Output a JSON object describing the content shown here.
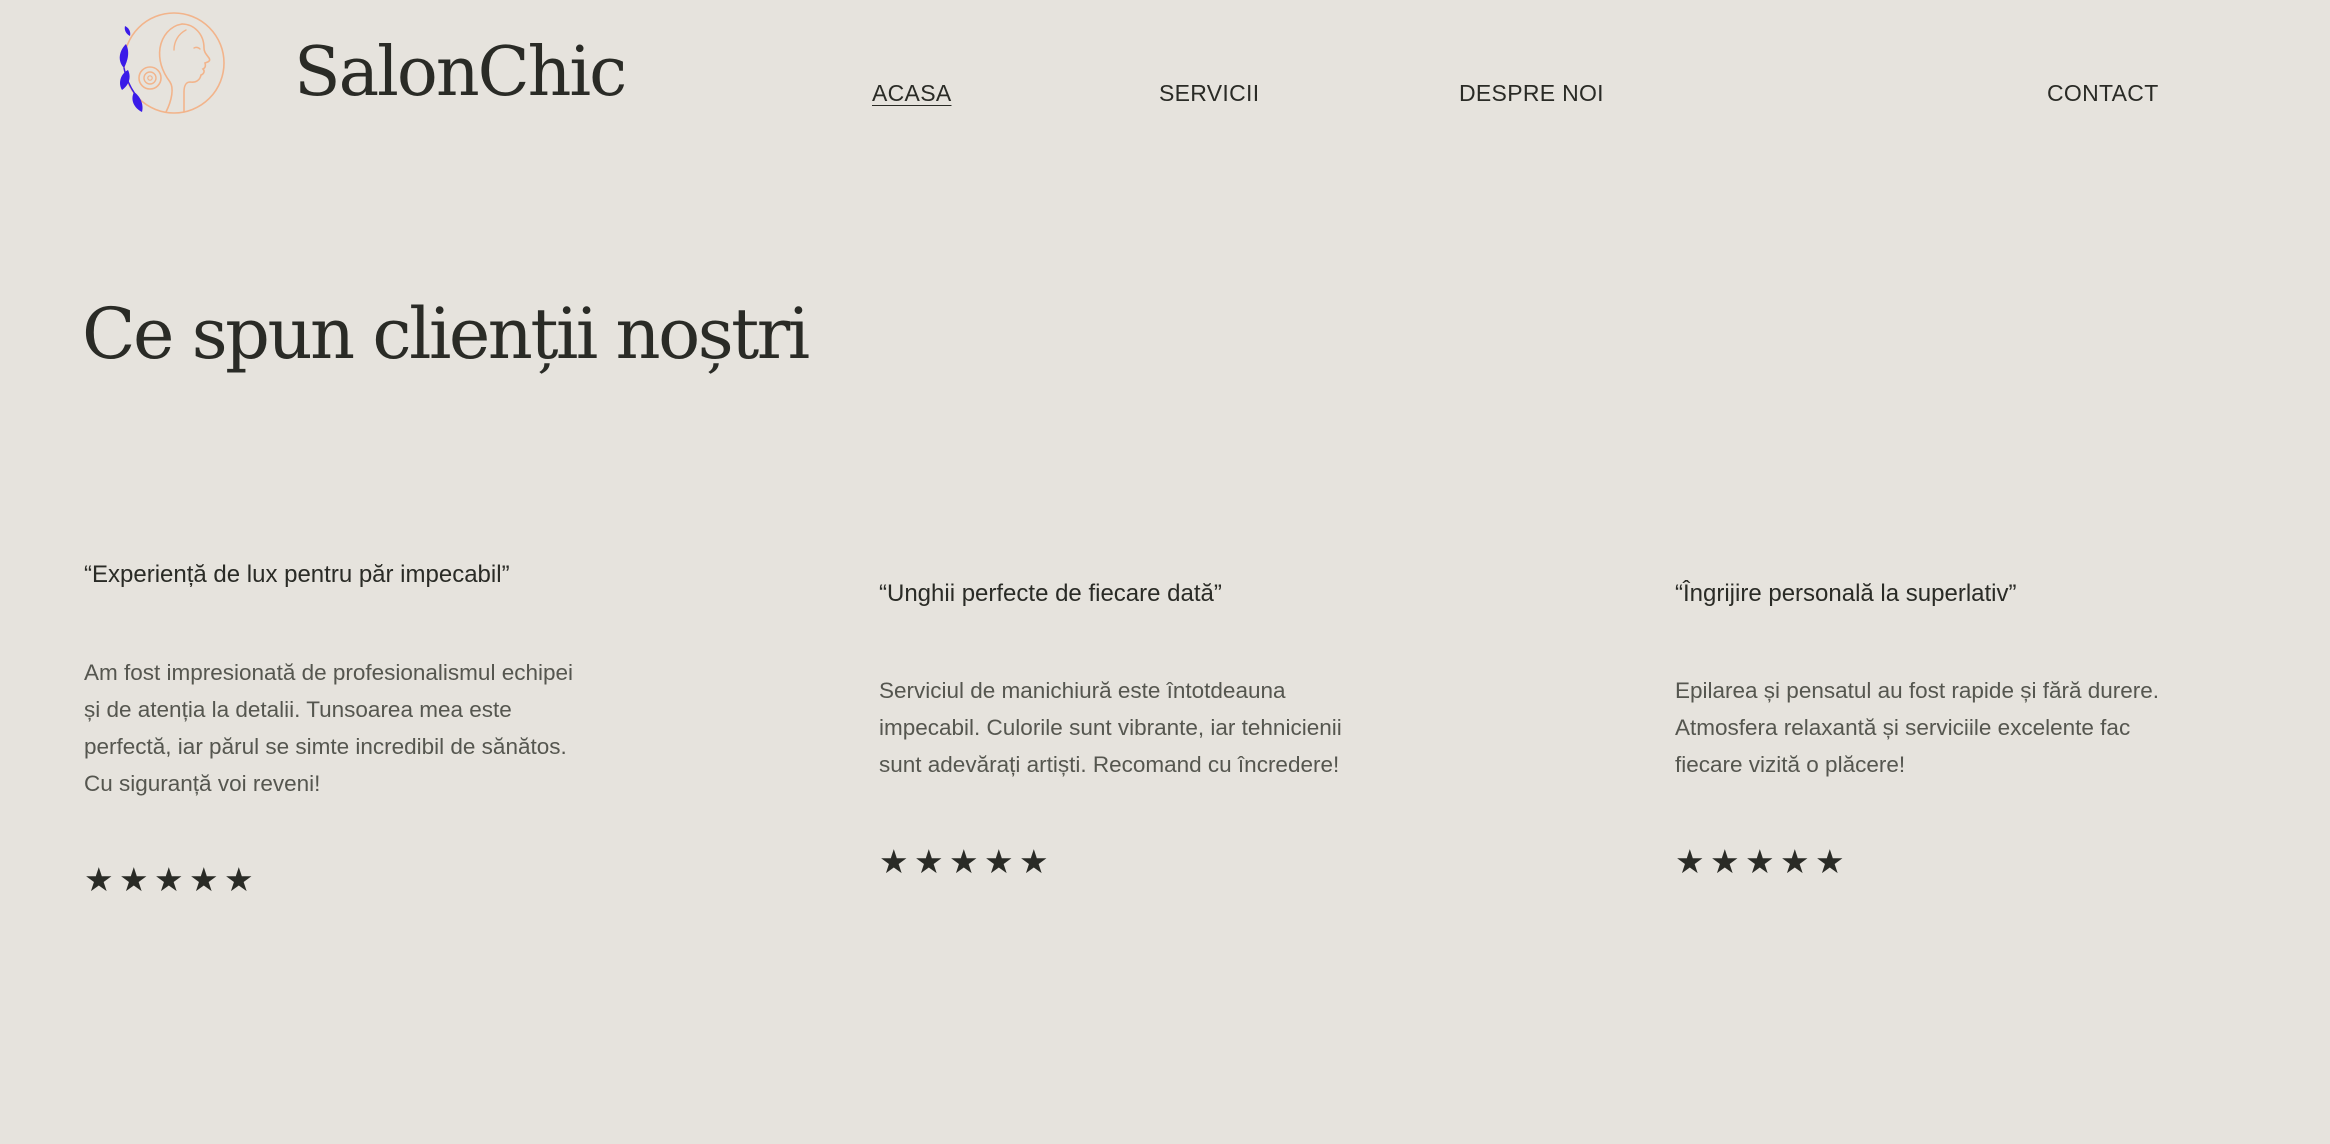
{
  "brand": {
    "name": "SalonChic",
    "logo_icon": "woman-profile-with-flower-logo",
    "logo_colors": {
      "outline": "#F2B48B",
      "leaves": "#3A1BE8"
    }
  },
  "nav": {
    "items": [
      {
        "label": "ACASA",
        "active": true
      },
      {
        "label": "SERVICII",
        "active": false
      },
      {
        "label": "DESPRE NOI",
        "active": false
      },
      {
        "label": "CONTACT",
        "active": false
      }
    ]
  },
  "testimonials": {
    "title": "Ce spun clienții noștri",
    "items": [
      {
        "title": "“Experiență de lux pentru păr impecabil”",
        "lines": [
          "Am fost impresionată de profesionalismul echipei",
          "și de atenția la detalii. Tunsoarea mea este",
          "perfectă, iar părul se simte incredibil de sănătos.",
          "Cu siguranță voi reveni!"
        ],
        "rating": 5,
        "star_glyph": "★"
      },
      {
        "title": "“Unghii perfecte de fiecare dată”",
        "lines": [
          "Serviciul de manichiură este întotdeauna",
          "impecabil. Culorile sunt vibrante, iar tehnicienii",
          "sunt adevărați artiști. Recomand cu încredere!"
        ],
        "rating": 5,
        "star_glyph": "★"
      },
      {
        "title": "“Îngrijire personală la superlativ”",
        "lines": [
          "Epilarea și pensatul au fost rapide și fără durere.",
          "Atmosfera relaxantă și serviciile excelente fac",
          "fiecare vizită o plăcere!"
        ],
        "rating": 5,
        "star_glyph": "★"
      }
    ]
  },
  "colors": {
    "background": "#E6E3DD",
    "text": "#2A2B26",
    "body_text": "#55564F"
  }
}
